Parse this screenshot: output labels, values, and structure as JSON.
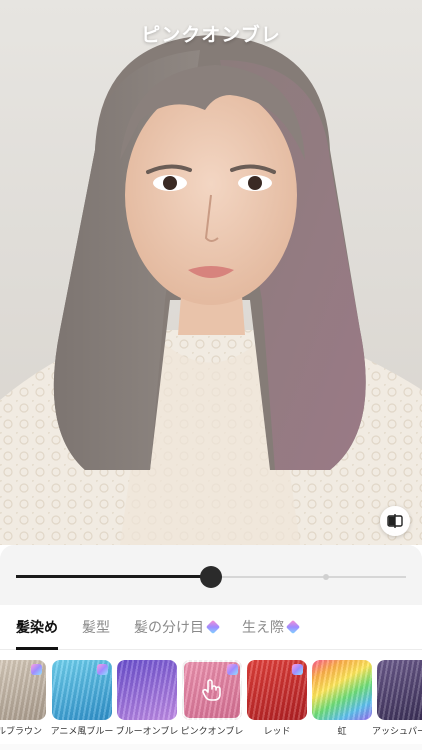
{
  "header": {
    "title": "ピンクオンブレ"
  },
  "slider": {
    "value_fraction": 0.5
  },
  "tabs": [
    {
      "label": "髪染め",
      "active": true,
      "premium": false
    },
    {
      "label": "髪型",
      "active": false,
      "premium": false
    },
    {
      "label": "髪の分け目",
      "active": false,
      "premium": true
    },
    {
      "label": "生え際",
      "active": false,
      "premium": true
    }
  ],
  "swatches": [
    {
      "label": "ールブラウン",
      "color_a": "#cdbfae",
      "color_b": "#a8998a",
      "premium": true
    },
    {
      "label": "アニメ風ブルー",
      "color_a": "#5ec6e8",
      "color_b": "#2b8fc9",
      "premium": true
    },
    {
      "label": "ブルーオンブレ",
      "color_a": "#7a5bd6",
      "color_b": "#b77ce0",
      "premium": false
    },
    {
      "label": "ピンクオンブレ",
      "color_a": "#e98aa8",
      "color_b": "#d66c90",
      "premium": true,
      "selected": true
    },
    {
      "label": "レッド",
      "color_a": "#d8332f",
      "color_b": "#b21f22",
      "premium": true
    },
    {
      "label": "虹",
      "color_a": "#f25d8e",
      "color_b": "#5ec1f0",
      "premium": false
    },
    {
      "label": "アッシュパープ",
      "color_a": "#5a4a78",
      "color_b": "#3a2f55",
      "premium": false
    }
  ],
  "icons": {
    "compare": "compare-icon",
    "gem": "premium-gem-icon",
    "hand": "hand-pointer-icon"
  }
}
